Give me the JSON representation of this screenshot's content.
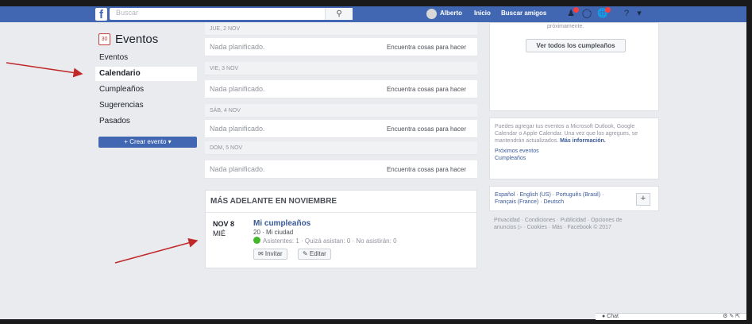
{
  "topbar": {
    "logo": "f",
    "search_placeholder": "Buscar",
    "search_icon": "magnifier-icon",
    "user_name": "Alberto",
    "home_label": "Inicio",
    "find_friends_label": "Buscar amigos",
    "icons": [
      "friends-icon",
      "messenger-icon",
      "notifications-icon",
      "help-icon",
      "caret-down-icon"
    ]
  },
  "sidebar": {
    "title": "Eventos",
    "cal_icon_text": "30",
    "items": [
      {
        "label": "Eventos"
      },
      {
        "label": "Calendario"
      },
      {
        "label": "Cumpleaños"
      },
      {
        "label": "Sugerencias"
      },
      {
        "label": "Pasados"
      }
    ],
    "create_label": "+ Crear evento ▾"
  },
  "calendar": {
    "days": [
      {
        "header": "JUE, 2 NOV",
        "empty": "Nada planificado.",
        "action": "Encuentra cosas para hacer"
      },
      {
        "header": "VIE, 3 NOV",
        "empty": "Nada planificado.",
        "action": "Encuentra cosas para hacer"
      },
      {
        "header": "SÁB, 4 NOV",
        "empty": "Nada planificado.",
        "action": "Encuentra cosas para hacer"
      },
      {
        "header": "DOM, 5 NOV",
        "empty": "Nada planificado.",
        "action": "Encuentra cosas para hacer"
      }
    ],
    "later_title": "MÁS ADELANTE EN NOVIEMBRE",
    "event": {
      "date": "NOV 8",
      "dow": "MIÉ",
      "name": "Mi cumpleaños",
      "location": "20 · Mi ciudad",
      "attendance": "Asistentes: 1 · Quizá asistan: 0 · No asistirán: 0",
      "invite_label": "✉ Invitar",
      "edit_label": "✎ Editar"
    }
  },
  "rightcol": {
    "upcoming_text": "próximamente.",
    "see_birthdays": "Ver todos los cumpleaños",
    "export_text": "Puedes agregar tus eventos a Microsoft Outlook, Google Calendar o Apple Calendar. Una vez que los agregues, se mantendrán actualizados.",
    "more_info": "Más información.",
    "upcoming_events": "Próximos eventos",
    "birthdays": "Cumpleaños",
    "languages_line1": "Español · English (US) · Português (Brasil) ·",
    "languages_line2": "Français (France) · Deutsch",
    "plus_label": "+",
    "footer": "Privacidad · Condiciones · Publicidad · Opciones de anuncios ▷ · Cookies · Más · Facebook © 2017"
  },
  "chat": {
    "label": "● Chat",
    "icons": "⚙ ✎ ⇱"
  }
}
